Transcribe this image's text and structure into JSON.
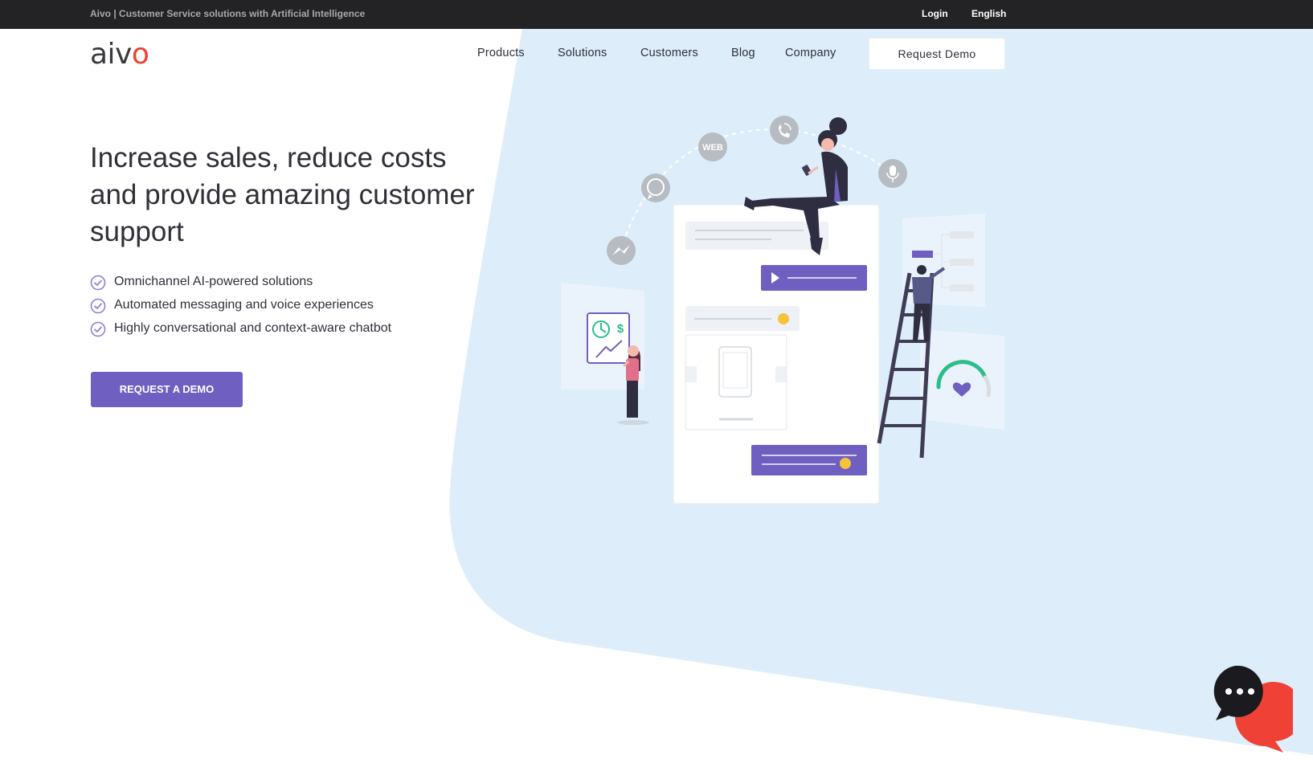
{
  "topbar": {
    "tagline": "Aivo | Customer Service solutions with Artificial Intelligence",
    "login_label": "Login",
    "language_label": "English"
  },
  "header": {
    "logo": {
      "main": "aiv",
      "accent": "o"
    },
    "nav": [
      {
        "label": "Products"
      },
      {
        "label": "Solutions"
      },
      {
        "label": "Customers"
      },
      {
        "label": "Blog"
      },
      {
        "label": "Company"
      }
    ],
    "cta_label": "Request Demo"
  },
  "hero": {
    "title": "Increase sales, reduce costs and provide amazing customer support",
    "features": [
      "Omnichannel AI-powered solutions",
      "Automated messaging and voice experiences",
      "Highly conversational and context-aware chatbot"
    ],
    "cta_label": "REQUEST A DEMO"
  },
  "illustration": {
    "channels": [
      {
        "icon": "messenger-icon"
      },
      {
        "icon": "whatsapp-icon"
      },
      {
        "icon": "web-icon",
        "label": "WEB"
      },
      {
        "icon": "phone-icon"
      },
      {
        "icon": "microphone-icon"
      }
    ]
  },
  "colors": {
    "topbar": "#232325",
    "accent": "#6f5fc0",
    "brand_red": "#ef4135",
    "background_shape": "#ddeefa",
    "text": "#2f2f3a"
  }
}
